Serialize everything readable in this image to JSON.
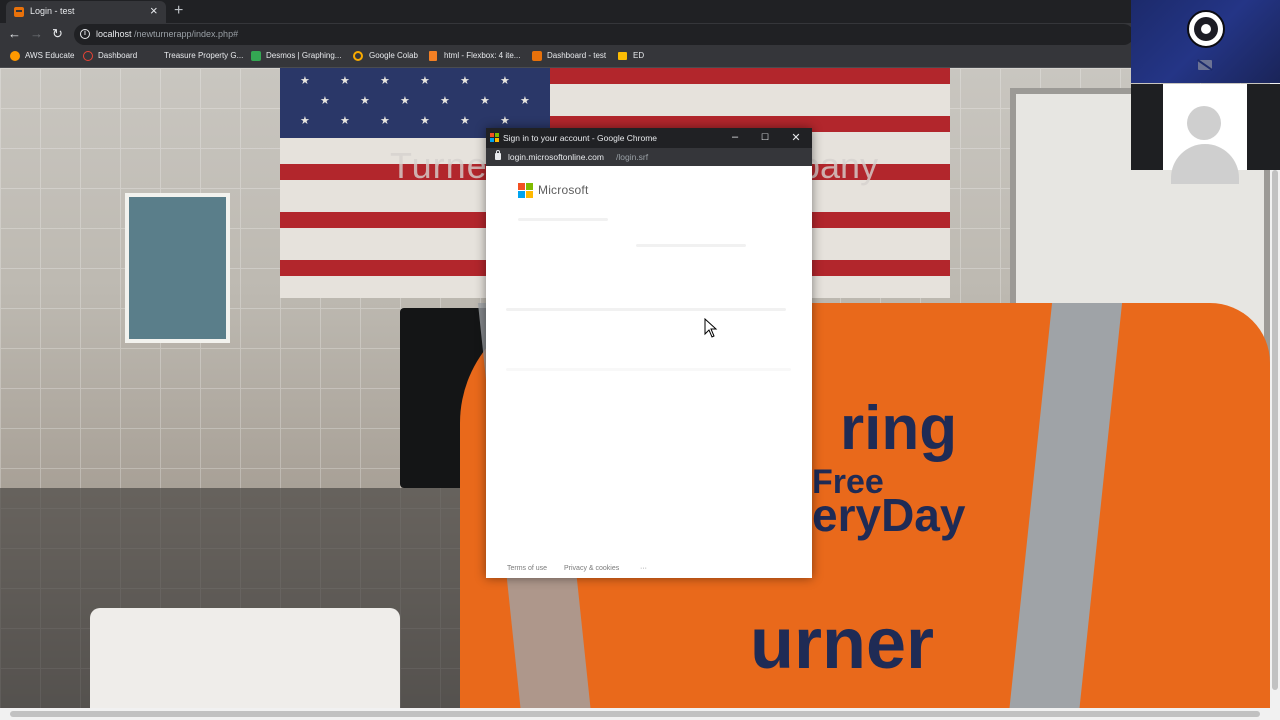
{
  "browser": {
    "tab_title": "Login - test",
    "url_host": "localhost",
    "url_path": "/newturnerapp/index.php#"
  },
  "bookmarks": [
    {
      "label": "AWS Educate",
      "icon": "aws-icon",
      "color": "#ff9900"
    },
    {
      "label": "Dashboard",
      "icon": "dashboard-icon",
      "color": "#ea4335"
    },
    {
      "label": "Treasure Property G...",
      "icon": "",
      "color": ""
    },
    {
      "label": "Desmos | Graphing...",
      "icon": "desmos-icon",
      "color": "#34a853"
    },
    {
      "label": "Google Colab",
      "icon": "colab-icon",
      "color": "#f9ab00"
    },
    {
      "label": "html - Flexbox: 4 ite...",
      "icon": "stackoverflow-icon",
      "color": "#f48024"
    },
    {
      "label": "Dashboard - test",
      "icon": "dashboard-icon",
      "color": "#e8710a"
    },
    {
      "label": "ED",
      "icon": "folder-icon",
      "color": "#fbbc04"
    }
  ],
  "page": {
    "title_left": "Turne",
    "title_right": "pany"
  },
  "vest": {
    "line1": "ring",
    "line2": "Free",
    "line3": "eryDay",
    "line4": "urner"
  },
  "popup": {
    "window_title": "Sign in to your account - Google Chrome",
    "url_host": "login.microsoftonline.com",
    "url_path": "/login.srf",
    "brand": "Microsoft",
    "footer": {
      "terms": "Terms of use",
      "privacy": "Privacy & cookies",
      "more": "···"
    }
  },
  "colors": {
    "ms_red": "#f25022",
    "ms_green": "#7fba00",
    "ms_blue": "#00a4ef",
    "ms_yellow": "#ffb900",
    "vest_orange": "#e9691b",
    "obs_blue": "#243586"
  }
}
